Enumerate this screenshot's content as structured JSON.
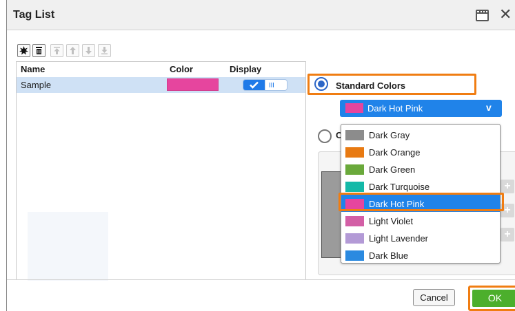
{
  "window": {
    "title": "Tag List"
  },
  "table": {
    "headers": {
      "name": "Name",
      "color": "Color",
      "display": "Display"
    },
    "rows": [
      {
        "name": "Sample",
        "color": "#e6459e",
        "display_on": true
      }
    ]
  },
  "color_mode": {
    "standard_label": "Standard Colors",
    "custom_label_visible_fragment": "C",
    "selected": "standard"
  },
  "color_select": {
    "value": "Dark Hot Pink",
    "swatch": "#e6459e"
  },
  "color_options": [
    {
      "label": "Dark Gray",
      "color": "#8c8c8c"
    },
    {
      "label": "Dark Orange",
      "color": "#e87a12"
    },
    {
      "label": "Dark Green",
      "color": "#6aa93b"
    },
    {
      "label": "Dark Turquoise",
      "color": "#14b9a8"
    },
    {
      "label": "Dark Hot Pink",
      "color": "#e6459e",
      "selected": true
    },
    {
      "label": "Light Violet",
      "color": "#d35fa6"
    },
    {
      "label": "Light Lavender",
      "color": "#b39ad6"
    },
    {
      "label": "Dark Blue",
      "color": "#2b8ae0"
    }
  ],
  "buttons": {
    "cancel": "Cancel",
    "ok": "OK"
  },
  "accent": {
    "highlight": "#f07d12",
    "primary": "#2083e9",
    "ok": "#4caf2c"
  }
}
